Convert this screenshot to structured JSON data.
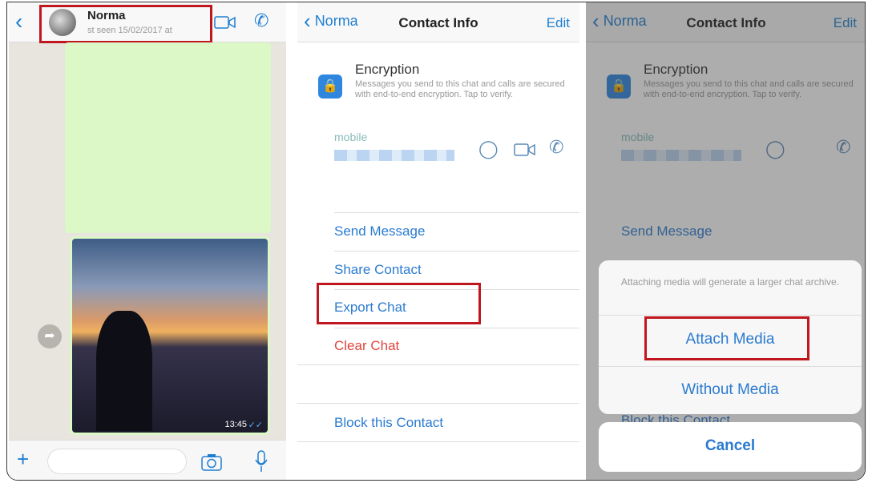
{
  "chat": {
    "contact_name": "Norma",
    "last_seen": "st seen 15/02/2017 at",
    "message_time": "13:45",
    "icons": [
      "back-chevron-icon",
      "avatar",
      "video-call-icon",
      "phone-icon",
      "forward-icon",
      "plus-icon",
      "camera-icon",
      "microphone-icon",
      "double-check-icon"
    ]
  },
  "contact_info": {
    "back_label": "Norma",
    "title": "Contact Info",
    "edit_label": "Edit",
    "encryption_title": "Encryption",
    "encryption_text": "Messages you send to this chat and calls are secured with end-to-end encryption. Tap to verify.",
    "phone_label": "mobile",
    "actions": [
      "Send Message",
      "Share Contact",
      "Export Chat",
      "Clear Chat"
    ],
    "block_label": "Block this Contact"
  },
  "export_sheet": {
    "message": "Attaching media will generate a larger chat archive.",
    "attach_label": "Attach Media",
    "without_label": "Without Media",
    "cancel_label": "Cancel"
  },
  "colors": {
    "accent": "#1f7fd1",
    "highlight": "#c0171f",
    "destructive": "#e0453c",
    "bubble": "#dcf8c6"
  }
}
